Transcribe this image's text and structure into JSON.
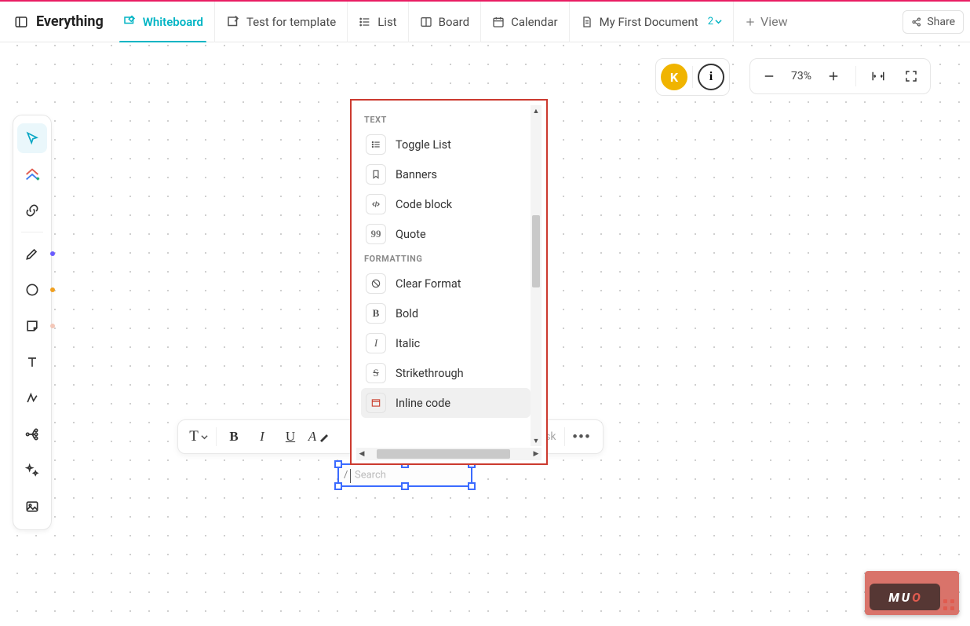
{
  "header": {
    "title": "Everything",
    "tabs": [
      {
        "label": "Whiteboard",
        "icon": "whiteboard-icon",
        "active": true
      },
      {
        "label": "Test for template",
        "icon": "template-icon"
      },
      {
        "label": "List",
        "icon": "list-icon"
      },
      {
        "label": "Board",
        "icon": "board-icon"
      },
      {
        "label": "Calendar",
        "icon": "calendar-icon"
      },
      {
        "label": "My First Document",
        "icon": "document-icon",
        "badge": "2"
      }
    ],
    "add_view": "View",
    "share": "Share"
  },
  "top_controls": {
    "avatar_letter": "K",
    "zoom": "73%"
  },
  "left_tools": {
    "items": [
      {
        "name": "cursor-tool",
        "selected": true
      },
      {
        "name": "home-plus-tool"
      },
      {
        "name": "link-tool",
        "divider_after": true
      },
      {
        "name": "pen-tool",
        "dot": "#6a5cff"
      },
      {
        "name": "circle-tool",
        "dot": "#f0a020"
      },
      {
        "name": "sticky-tool",
        "dot": "#f3c7b8"
      },
      {
        "name": "text-tool"
      },
      {
        "name": "connector-tool"
      },
      {
        "name": "mindmap-tool"
      },
      {
        "name": "sparkle-tool"
      },
      {
        "name": "image-tool"
      }
    ]
  },
  "format_bar": {
    "text_style": "T",
    "items": [
      "B",
      "I",
      "U",
      "A"
    ],
    "task": "Task"
  },
  "text_box": {
    "slash": "/",
    "placeholder": "Search"
  },
  "popup": {
    "sections": [
      {
        "heading": "TEXT",
        "items": [
          {
            "icon": "toggle-list-icon",
            "label": "Toggle List"
          },
          {
            "icon": "bookmark-icon",
            "label": "Banners"
          },
          {
            "icon": "code-icon",
            "label": "Code block"
          },
          {
            "icon": "quote-icon",
            "label": "Quote"
          }
        ]
      },
      {
        "heading": "FORMATTING",
        "items": [
          {
            "icon": "clear-format-icon",
            "label": "Clear Format"
          },
          {
            "icon": "bold-icon",
            "label": "Bold"
          },
          {
            "icon": "italic-icon",
            "label": "Italic"
          },
          {
            "icon": "strike-icon",
            "label": "Strikethrough"
          },
          {
            "icon": "inline-code-icon",
            "label": "Inline code",
            "selected": true
          }
        ]
      }
    ]
  },
  "brand_badge": {
    "m": "M",
    "u": "U",
    "o": "O"
  }
}
